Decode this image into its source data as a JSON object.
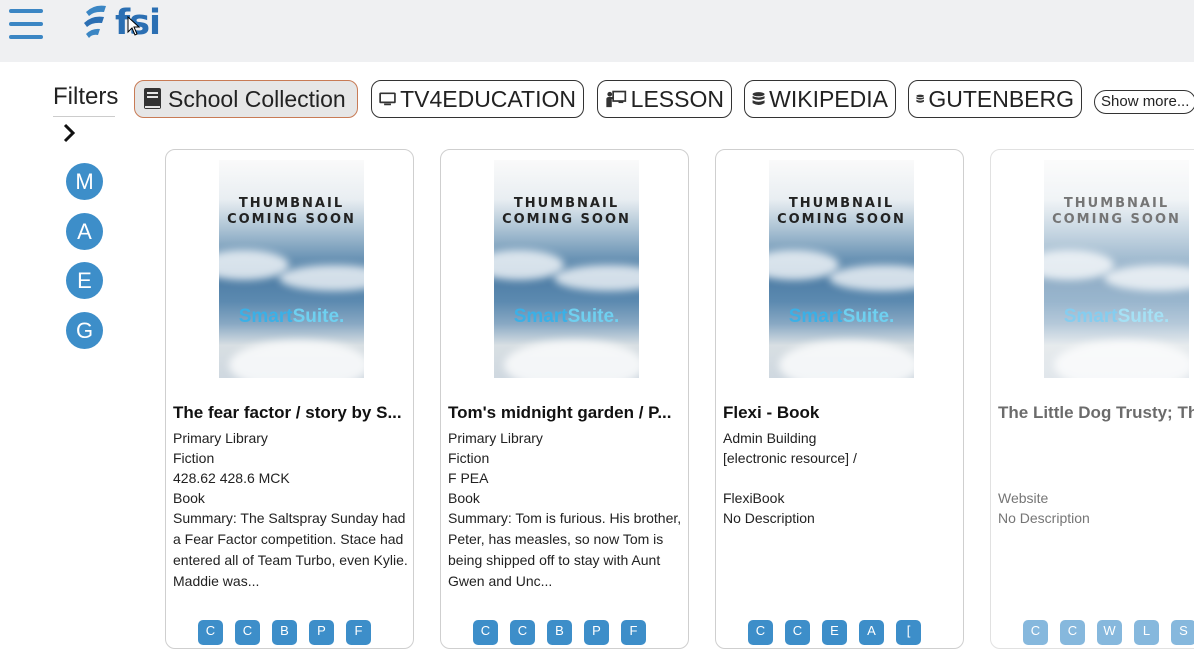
{
  "header": {
    "logo_text": "fsi"
  },
  "filters": {
    "label": "Filters",
    "chips": [
      {
        "label": "School Collection",
        "icon": "book-icon",
        "active": true
      },
      {
        "label": "TV4EDUCATION",
        "icon": "monitor-icon",
        "active": false
      },
      {
        "label": "LESSON",
        "icon": "teacher-board-icon",
        "active": false
      },
      {
        "label": "WIKIPEDIA",
        "icon": "database-icon",
        "active": false
      },
      {
        "label": "GUTENBERG",
        "icon": "database-icon",
        "active": false
      }
    ],
    "show_more": "Show more..."
  },
  "letters": [
    "M",
    "A",
    "E",
    "G"
  ],
  "thumbnail": {
    "line1": "THUMBNAIL",
    "line2": "COMING SOON",
    "brand_a": "Smart",
    "brand_b": "Suite",
    "brand_dot": "."
  },
  "cards": [
    {
      "title": "The fear factor / story by S...",
      "lines": [
        "Primary Library",
        "Fiction",
        "428.62 428.6 MCK",
        "Book"
      ],
      "summary": "Summary: The Saltspray Sunday had a Fear Factor competition. Stace had entered all of Team Turbo, even Kylie. Maddie was...",
      "tags": [
        "C",
        "C",
        "B",
        "P",
        "F"
      ]
    },
    {
      "title": "Tom's midnight garden / P...",
      "lines": [
        "Primary Library",
        "Fiction",
        "F PEA",
        "Book"
      ],
      "summary": "Summary: Tom is furious. His brother, Peter, has measles, so now Tom is being shipped off to stay with Aunt Gwen and Unc...",
      "tags": [
        "C",
        "C",
        "B",
        "P",
        "F"
      ]
    },
    {
      "title": "Flexi - Book",
      "lines": [
        "Admin Building",
        "[electronic resource] /",
        "",
        "FlexiBook",
        "No Description"
      ],
      "summary": "",
      "tags": [
        "C",
        "C",
        "E",
        "A",
        "["
      ]
    },
    {
      "title": "The Little Dog Trusty; Th",
      "lines": [
        "",
        "",
        "",
        "Website",
        "No Description"
      ],
      "summary": "",
      "tags": [
        "C",
        "C",
        "W",
        "L",
        "S"
      ]
    }
  ]
}
